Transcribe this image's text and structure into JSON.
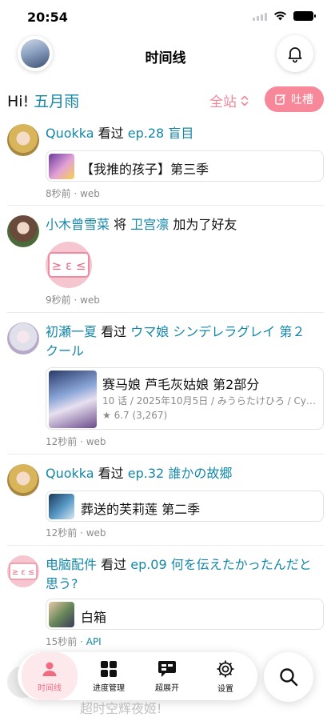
{
  "status": {
    "time": "20:54"
  },
  "header": {
    "title": "时间线"
  },
  "greeting": {
    "prefix": "Hi!",
    "user": "五月雨"
  },
  "site_filter": {
    "label": "全站"
  },
  "rant_button": {
    "label": "吐槽"
  },
  "feed": [
    {
      "user": "Quokka",
      "action": "看过",
      "target": "ep.28 盲目",
      "card": {
        "title": "【我推的孩子】第三季"
      },
      "time": "8秒前",
      "via": "web"
    },
    {
      "user": "小木曾雪菜",
      "action": "将",
      "target": "卫宫凛",
      "suffix": "加为了好友",
      "time": "9秒前",
      "via": "web"
    },
    {
      "user": "初瀬一夏",
      "action": "看过",
      "target": "ウマ娘 シンデレラグレイ 第２クール",
      "card": {
        "title": "赛马娘 芦毛灰姑娘 第2部分",
        "info": "10 话 / 2025年10月5日 / みうらたけひろ / Cy…",
        "rating": "★ 6.7 (3,267)"
      },
      "time": "12秒前",
      "via": "web"
    },
    {
      "user": "Quokka",
      "action": "看过",
      "target": "ep.32 誰かの故郷",
      "card": {
        "title": "葬送的芙莉莲 第二季"
      },
      "time": "12秒前",
      "via": "web"
    },
    {
      "user": "电脑配件",
      "action": "看过",
      "target": "ep.09 何を伝えたかったんだと思う?",
      "card": {
        "title": "白箱"
      },
      "time": "15秒前",
      "via": "API"
    }
  ],
  "partial_item": {
    "title": "超时空辉夜姬!"
  },
  "tabs": [
    {
      "label": "时间线",
      "icon": "person-icon"
    },
    {
      "label": "进度管理",
      "icon": "grid-icon"
    },
    {
      "label": "超展开",
      "icon": "chat-bubble-icon"
    },
    {
      "label": "设置",
      "icon": "gear-icon"
    }
  ],
  "colors": {
    "link": "#1487a8",
    "accent": "#f7889a",
    "active_tab_bg": "#fde8ec"
  }
}
